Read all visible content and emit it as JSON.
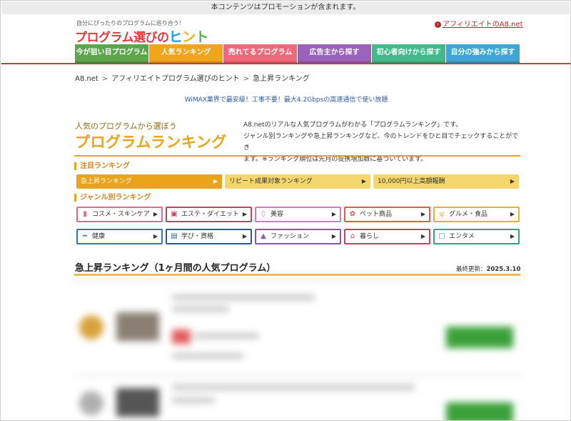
{
  "promo_notice": "本コンテンツはプロモーションが含まれます。",
  "header": {
    "tagline": "自分にぴったりのプログラムに巡り合う！",
    "logo_part1": "プログラム選びの",
    "logo_hint": [
      "ヒ",
      "ン",
      "ト"
    ],
    "a8_link": "アフィリエイトのA8.net"
  },
  "global_nav": [
    {
      "label": "今が狙い目プログラム",
      "color": "#5aa64a"
    },
    {
      "label": "人気ランキング",
      "color": "#f1a51d"
    },
    {
      "label": "売れてるプログラム",
      "color": "#ee6a7b"
    },
    {
      "label": "広告主から探す",
      "color": "#9a62b8"
    },
    {
      "label": "初心者向けから探す",
      "color": "#3dbb8a"
    },
    {
      "label": "自分の強みから探す",
      "color": "#3aa8d4"
    }
  ],
  "breadcrumb": [
    "A8.net",
    "アフィリエイトプログラム選びのヒント",
    "急上昇ランキング"
  ],
  "ad_text": "WiMAX業界で最安級！工事不要！最大4.2Gbpsの高速通信で使い放題",
  "lead": {
    "subtitle": "人気のプログラムから選ぼう",
    "title": "プログラムランキング",
    "desc_lines": [
      "A8.netのリアルな人気プログラムがわかる「プログラムランキング」です。",
      "ジャンル別ランキングや急上昇ランキングなど、今のトレンドをひと目でチェックすることができ",
      "ます。※ランキング順位は先月の提携増加数に基づいています。"
    ]
  },
  "featured": {
    "heading": "注目ランキング",
    "tabs": [
      {
        "label": "急上昇ランキング",
        "active": true
      },
      {
        "label": "リピート成果対象ランキング",
        "active": false
      },
      {
        "label": "10,000円以上高額報酬",
        "active": false
      }
    ]
  },
  "genre": {
    "heading": "ジャンル別ランキング",
    "items": [
      {
        "label": "コスメ・スキンケア",
        "icon": "lipstick-icon",
        "glyph": "▮",
        "color": "#e8668a"
      },
      {
        "label": "エステ・ダイエット",
        "icon": "beauty-salon-icon",
        "glyph": "▣",
        "color": "#c4445e"
      },
      {
        "label": "美容",
        "icon": "mirror-icon",
        "glyph": "◊",
        "color": "#d77bc0"
      },
      {
        "label": "ペット商品",
        "icon": "pet-icon",
        "glyph": "✿",
        "color": "#e25b4b"
      },
      {
        "label": "グルメ・食品",
        "icon": "cutlery-icon",
        "glyph": "ψ",
        "color": "#e8b32a"
      },
      {
        "label": "健康",
        "icon": "dumbbell-icon",
        "glyph": "━",
        "color": "#3d6fbf"
      },
      {
        "label": "学び・資格",
        "icon": "book-icon",
        "glyph": "▤",
        "color": "#2f5c8f"
      },
      {
        "label": "ファッション",
        "icon": "dress-icon",
        "glyph": "▲",
        "color": "#8a56b0"
      },
      {
        "label": "暮らし",
        "icon": "house-icon",
        "glyph": "⌂",
        "color": "#c4445e"
      },
      {
        "label": "エンタメ",
        "icon": "entertainment-icon",
        "glyph": "▢",
        "color": "#3a9e84"
      }
    ]
  },
  "ranking": {
    "title": "急上昇ランキング（1ヶ月間の人気プログラム）",
    "updated_label": "最終更新：",
    "updated_date": "2025.3.10"
  }
}
